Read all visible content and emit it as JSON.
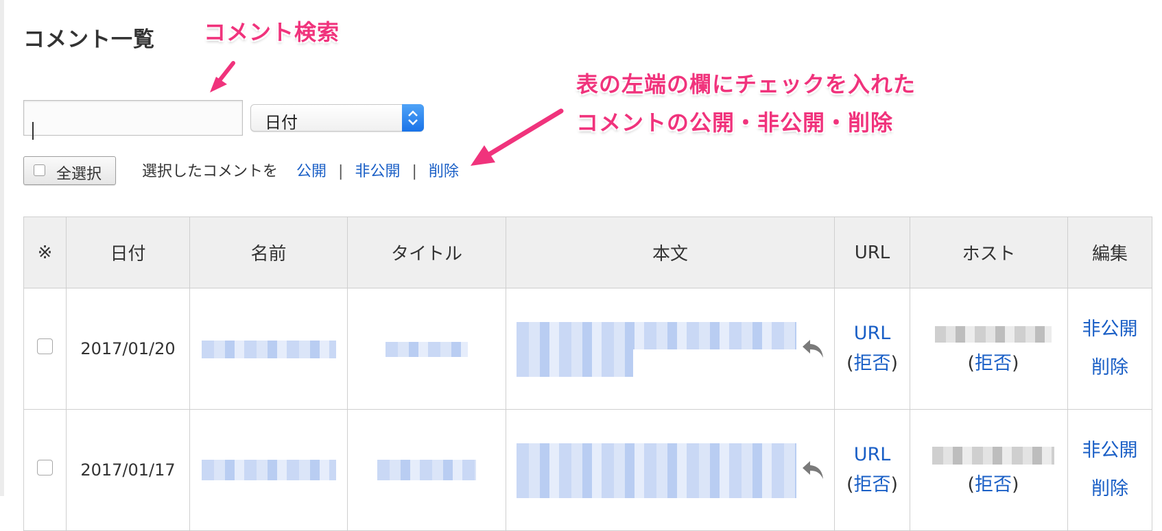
{
  "page": {
    "title": "コメント一覧"
  },
  "annotations": {
    "search": "コメント検索",
    "bulk_line1": "表の左端の欄にチェックを入れた",
    "bulk_line2": "コメントの公開・非公開・削除"
  },
  "search": {
    "value": "",
    "placeholder": ""
  },
  "sort": {
    "selected": "日付"
  },
  "bulk": {
    "select_all": "全選択",
    "lead": "選択したコメントを",
    "publish": "公開",
    "unpublish": "非公開",
    "delete": "削除",
    "separator": "|"
  },
  "table": {
    "columns": [
      "※",
      "日付",
      "名前",
      "タイトル",
      "本文",
      "URL",
      "ホスト",
      "編集"
    ],
    "rows": [
      {
        "date": "2017/01/20",
        "url": "URL",
        "url_reject": "拒否",
        "host_reject": "拒否",
        "edit_unpublish": "非公開",
        "edit_delete": "削除"
      },
      {
        "date": "2017/01/17",
        "url": "URL",
        "url_reject": "拒否",
        "host_reject": "拒否",
        "edit_unpublish": "非公開",
        "edit_delete": "削除"
      }
    ]
  },
  "colors": {
    "annotation": "#f0337c",
    "link": "#1a5fc6",
    "header_bg": "#efefef",
    "select_accent": "#1a73e8"
  },
  "icons": {
    "reply": "reply-arrow-icon",
    "select_arrows": "updown-chevron-icon"
  }
}
